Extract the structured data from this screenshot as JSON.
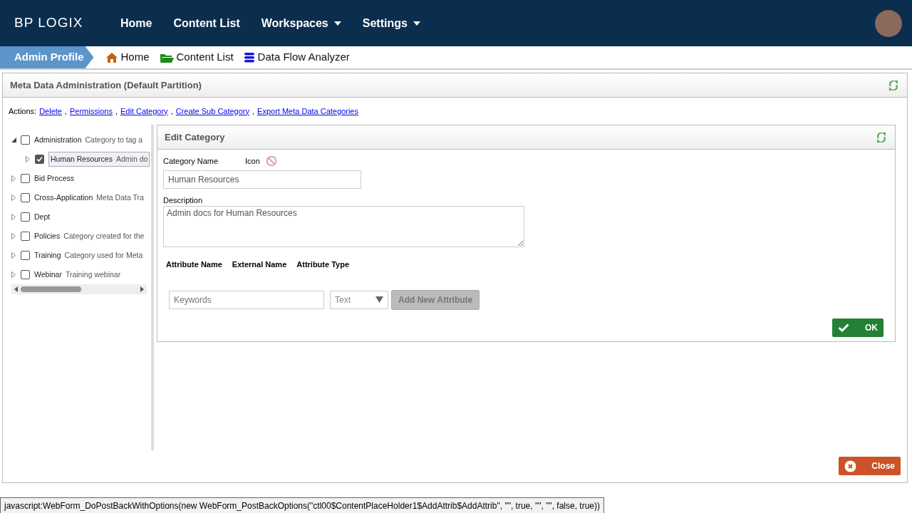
{
  "logo": "BP LOGIX",
  "nav": [
    {
      "label": "Home",
      "dropdown": false
    },
    {
      "label": "Content List",
      "dropdown": false
    },
    {
      "label": "Workspaces",
      "dropdown": true
    },
    {
      "label": "Settings",
      "dropdown": true
    }
  ],
  "breadcrumb": {
    "profile": "Admin Profile",
    "links": [
      {
        "label": "Home",
        "kind": "home"
      },
      {
        "label": "Content List",
        "kind": "folder"
      },
      {
        "label": "Data Flow Analyzer",
        "kind": "database"
      }
    ]
  },
  "panel": {
    "title": "Meta Data Administration (Default Partition)"
  },
  "actions": {
    "label": "Actions:",
    "separator": ",",
    "links": [
      "Delete",
      "Permissions",
      "Edit Category",
      "Create Sub Category",
      "Export Meta Data Categories"
    ]
  },
  "tree": [
    {
      "name": "Administration",
      "description": "Category to tag a",
      "checked": false,
      "selected": false,
      "expanded": true,
      "children": [
        {
          "name": "Human Resources",
          "description": "Admin do",
          "checked": true,
          "selected": true,
          "expanded": false
        }
      ]
    },
    {
      "name": "Bid Process",
      "checked": false,
      "selected": false,
      "expanded": false
    },
    {
      "name": "Cross-Application",
      "description": "Meta Data Tra",
      "checked": false,
      "selected": false,
      "expanded": false
    },
    {
      "name": "Dept",
      "checked": false,
      "selected": false,
      "expanded": false
    },
    {
      "name": "Policies",
      "description": "Category created for the",
      "checked": false,
      "selected": false,
      "expanded": false
    },
    {
      "name": "Training",
      "description": "Category used for Meta",
      "checked": false,
      "selected": false,
      "expanded": false
    },
    {
      "name": "Webinar",
      "description": "Training webinar",
      "checked": false,
      "selected": false,
      "expanded": false
    }
  ],
  "edit": {
    "title": "Edit Category",
    "category_name_label": "Category Name",
    "icon_label": "Icon",
    "category_name": "Human Resources",
    "description_label": "Description",
    "description": "Admin docs for Human Resources",
    "attribute_columns": [
      "Attribute Name",
      "External Name",
      "Attribute Type"
    ],
    "new_attribute": {
      "placeholder": "Keywords",
      "type": "Text",
      "type_disabled": true,
      "add_button": "Add New Attribute",
      "add_disabled": true
    },
    "ok_button": "OK"
  },
  "close_button": "Close",
  "status_bar": "javascript:WebForm_DoPostBackWithOptions(new WebForm_PostBackOptions(\"ctl00$ContentPlaceHolder1$AddAttrib$AddAttrib\", \"\", true, \"\", \"\", false, true))"
}
